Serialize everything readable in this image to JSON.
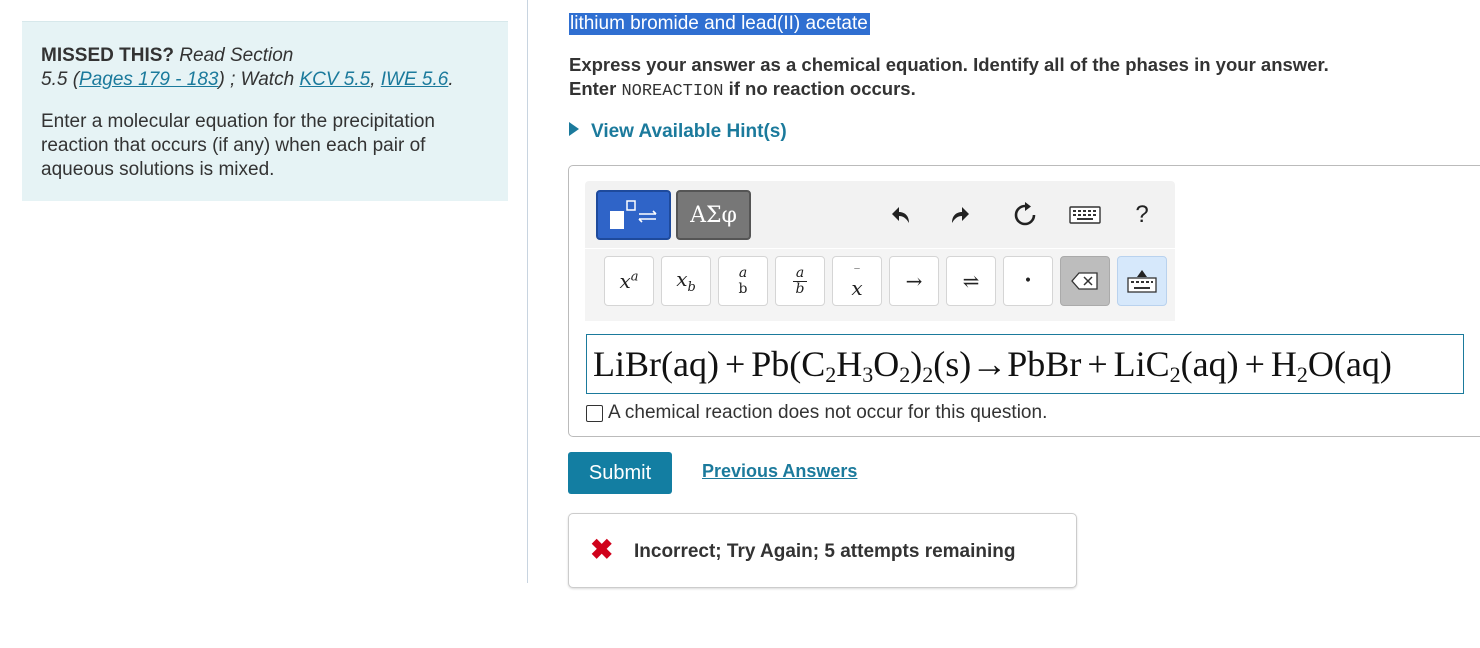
{
  "sidebar": {
    "missed_label": "MISSED THIS?",
    "read_section": "Read Section",
    "section_prefix": "5.5 (",
    "pages_link": "Pages 179 - 183",
    "watch_text": ") ; Watch",
    "kcv_link": "KCV 5.5",
    "comma": ",",
    "iwe_link": "IWE 5.6",
    "period": ".",
    "instructions": "Enter a molecular equation for the precipitation reaction that occurs (if any) when each pair of aqueous solutions is mixed."
  },
  "part": {
    "title": "lithium bromide and lead(II) acetate",
    "instruction_line1": "Express your answer as a chemical equation. Identify all of the phases in your answer.",
    "enter": "Enter",
    "noreaction": "NOREACTION",
    "instruction_tail": "if no reaction occurs.",
    "hint_label": "View Available Hint(s)"
  },
  "toolbar": {
    "greek_label": "ΑΣφ",
    "help_label": "?",
    "keys": {
      "superscript": "xᵃ",
      "subscript": "x_b",
      "fraction_num": "a",
      "fraction_den": "b",
      "vector": "x",
      "arrow": "→",
      "equilibrium": "⇌",
      "dot": "•"
    }
  },
  "equation": {
    "value": "LiBr(aq)+Pb(C2H3O2)2(s)→PbBr+LiC2(aq)+H2O(aq)"
  },
  "no_reaction_checkbox": {
    "label": "A chemical reaction does not occur for this question.",
    "checked": false
  },
  "actions": {
    "submit_label": "Submit",
    "previous_answers_label": "Previous Answers"
  },
  "feedback": {
    "icon": "✖",
    "message": "Incorrect; Try Again; 5 attempts remaining",
    "color": "#d0021b"
  },
  "colors": {
    "accent": "#1b7a9c",
    "sidebar_bg": "#e6f3f5",
    "template_button": "#2f64c8"
  }
}
